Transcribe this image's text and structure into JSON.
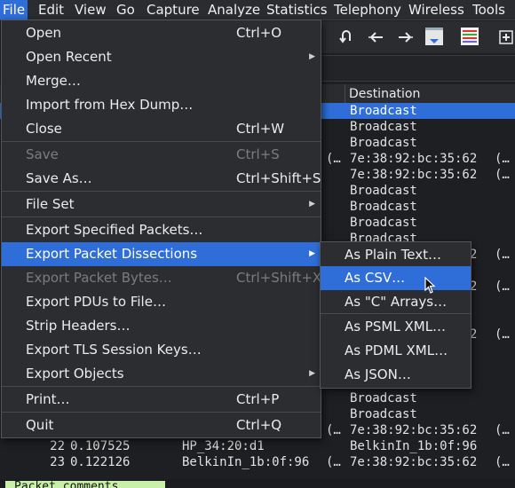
{
  "menubar": {
    "items": [
      "File",
      "Edit",
      "View",
      "Go",
      "Capture",
      "Analyze",
      "Statistics",
      "Telephony",
      "Wireless",
      "Tools"
    ]
  },
  "toolbar": {
    "icons": [
      "go-first-icon",
      "go-back-icon",
      "go-forward-icon",
      "auto-scroll-icon",
      "colorize-icon",
      "zoom-in-icon"
    ]
  },
  "packet_list": {
    "column_destination": "Destination",
    "rows": [
      {
        "no": "",
        "time": "",
        "src": "",
        "srctail": "",
        "dst": "Broadcast",
        "dsttail": "",
        "sel": true
      },
      {
        "no": "",
        "time": "",
        "src": "",
        "srctail": "",
        "dst": "Broadcast",
        "dsttail": ""
      },
      {
        "no": "",
        "time": "",
        "src": "",
        "srctail": "",
        "dst": "Broadcast",
        "dsttail": ""
      },
      {
        "no": "",
        "time": "",
        "src": "",
        "srctail": "(…",
        "dst": "7e:38:92:bc:35:62",
        "dsttail": "(…"
      },
      {
        "no": "",
        "time": "",
        "src": "",
        "srctail": "",
        "dst": "7e:38:92:bc:35:62",
        "dsttail": "(…"
      },
      {
        "no": "",
        "time": "",
        "src": "",
        "srctail": "",
        "dst": "Broadcast",
        "dsttail": ""
      },
      {
        "no": "",
        "time": "",
        "src": "",
        "srctail": "",
        "dst": "Broadcast",
        "dsttail": ""
      },
      {
        "no": "",
        "time": "",
        "src": "",
        "srctail": "",
        "dst": "Broadcast",
        "dsttail": ""
      },
      {
        "no": "",
        "time": "",
        "src": "",
        "srctail": "",
        "dst": "Broadcast",
        "dsttail": ""
      },
      {
        "no": "",
        "time": "",
        "src": "",
        "srctail": "",
        "dst": "7e:38:92:bc:35:62",
        "dsttail": "(…"
      },
      {
        "no": "",
        "time": "",
        "src": "",
        "srctail": "",
        "dst": "HP_34:20:d1",
        "dsttail": ""
      },
      {
        "no": "",
        "time": "",
        "src": "",
        "srctail": "",
        "dst": "7e:38:92:bc:35:62",
        "dsttail": "(…"
      },
      {
        "no": "",
        "time": "",
        "src": "",
        "srctail": "",
        "dst": "HP_34:20:d1",
        "dsttail": ""
      },
      {
        "no": "",
        "time": "",
        "src": "",
        "srctail": "",
        "dst": "",
        "dsttail": ""
      },
      {
        "no": "",
        "time": "",
        "src": "",
        "srctail": "",
        "dst": "7e:38:92:bc:35:62",
        "dsttail": "(…"
      },
      {
        "no": "",
        "time": "",
        "src": "",
        "srctail": "",
        "dst": "",
        "dsttail": ""
      },
      {
        "no": "",
        "time": "",
        "src": "",
        "srctail": "",
        "dst": "",
        "dsttail": ""
      },
      {
        "no": "",
        "time": "",
        "src": "",
        "srctail": "",
        "dst": "",
        "dsttail": ""
      },
      {
        "no": "",
        "time": "",
        "src": "",
        "srctail": "",
        "dst": "Broadcast",
        "dsttail": ""
      },
      {
        "no": "",
        "time": "",
        "src": "",
        "srctail": "",
        "dst": "Broadcast",
        "dsttail": ""
      },
      {
        "no": "",
        "time": "",
        "src": "",
        "srctail": "(…",
        "dst": "7e:38:92:bc:35:62",
        "dsttail": "(…"
      },
      {
        "no": "22",
        "time": "0.107525",
        "src": "HP_34:20:d1",
        "srctail": "",
        "dst": "BelkinIn_1b:0f:96",
        "dsttail": ""
      },
      {
        "no": "23",
        "time": "0.122126",
        "src": "BelkinIn_1b:0f:96",
        "srctail": "(…",
        "dst": "7e:38:92:bc:35:62",
        "dsttail": "(…"
      }
    ]
  },
  "file_menu": {
    "items": [
      {
        "label": "Open",
        "shortcut": "Ctrl+O"
      },
      {
        "label": "Open Recent",
        "submenu": true
      },
      {
        "label": "Merge…"
      },
      {
        "label": "Import from Hex Dump…"
      },
      {
        "label": "Close",
        "shortcut": "Ctrl+W"
      },
      {
        "label": "Save",
        "shortcut": "Ctrl+S",
        "disabled": true
      },
      {
        "label": "Save As…",
        "shortcut": "Ctrl+Shift+S"
      },
      {
        "label": "File Set",
        "submenu": true
      },
      {
        "label": "Export Specified Packets…"
      },
      {
        "label": "Export Packet Dissections",
        "submenu": true,
        "highlighted": true
      },
      {
        "label": "Export Packet Bytes…",
        "shortcut": "Ctrl+Shift+X",
        "disabled": true
      },
      {
        "label": "Export PDUs to File…"
      },
      {
        "label": "Strip Headers…"
      },
      {
        "label": "Export TLS Session Keys…"
      },
      {
        "label": "Export Objects",
        "submenu": true
      },
      {
        "label": "Print…",
        "shortcut": "Ctrl+P"
      },
      {
        "label": "Quit",
        "shortcut": "Ctrl+Q"
      }
    ]
  },
  "export_submenu": {
    "items": [
      {
        "label": "As Plain Text…"
      },
      {
        "label": "As CSV…",
        "highlighted": true
      },
      {
        "label": "As \"C\" Arrays…"
      },
      {
        "label": "As PSML XML…"
      },
      {
        "label": "As PDML XML…"
      },
      {
        "label": "As JSON…"
      }
    ]
  },
  "status": {
    "comments_label": "Packet comments"
  },
  "colors": {
    "accent": "#2f6ed8",
    "menu_bg": "#2c2d31",
    "window_bg": "#1e1f22",
    "status_comments_bg": "#c8f0a8"
  }
}
